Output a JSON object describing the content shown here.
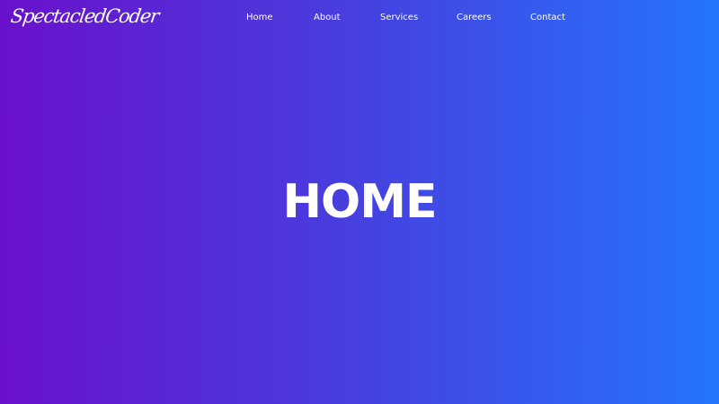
{
  "brand": {
    "logo_text": "SpectacledCoder"
  },
  "nav": {
    "items": [
      {
        "label": "Home"
      },
      {
        "label": "About"
      },
      {
        "label": "Services"
      },
      {
        "label": "Careers"
      },
      {
        "label": "Contact"
      }
    ]
  },
  "hero": {
    "title": "HOME"
  },
  "colors": {
    "gradient_start": "#6a11cb",
    "gradient_end": "#2575fc",
    "text": "#ffffff"
  }
}
